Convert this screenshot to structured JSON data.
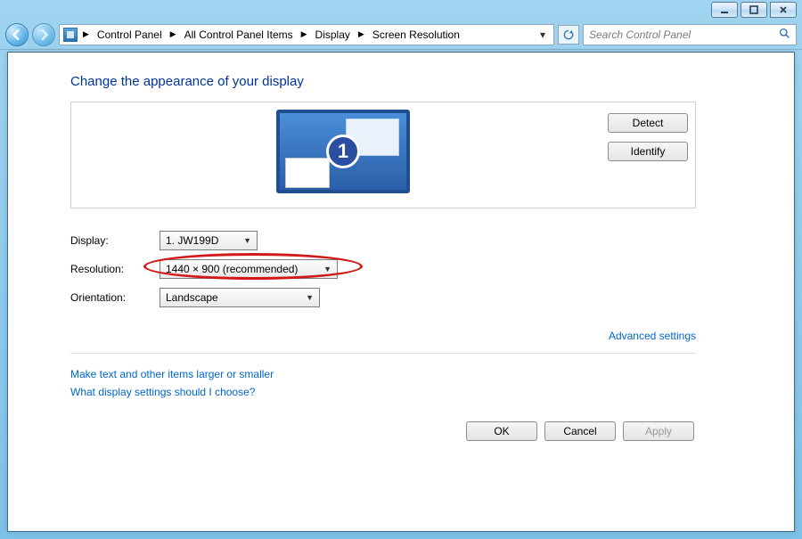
{
  "window": {
    "min_tip": "Minimize",
    "max_tip": "Maximize",
    "close_tip": "Close"
  },
  "nav": {
    "crumbs": [
      "Control Panel",
      "All Control Panel Items",
      "Display",
      "Screen Resolution"
    ],
    "search_placeholder": "Search Control Panel"
  },
  "page": {
    "title": "Change the appearance of your display"
  },
  "preview": {
    "monitor_number": "1",
    "detect_label": "Detect",
    "identify_label": "Identify"
  },
  "form": {
    "display_label": "Display:",
    "display_value": "1. JW199D",
    "resolution_label": "Resolution:",
    "resolution_value": "1440 × 900 (recommended)",
    "orientation_label": "Orientation:",
    "orientation_value": "Landscape"
  },
  "links": {
    "advanced": "Advanced settings",
    "textsize": "Make text and other items larger or smaller",
    "help": "What display settings should I choose?"
  },
  "actions": {
    "ok": "OK",
    "cancel": "Cancel",
    "apply": "Apply"
  }
}
